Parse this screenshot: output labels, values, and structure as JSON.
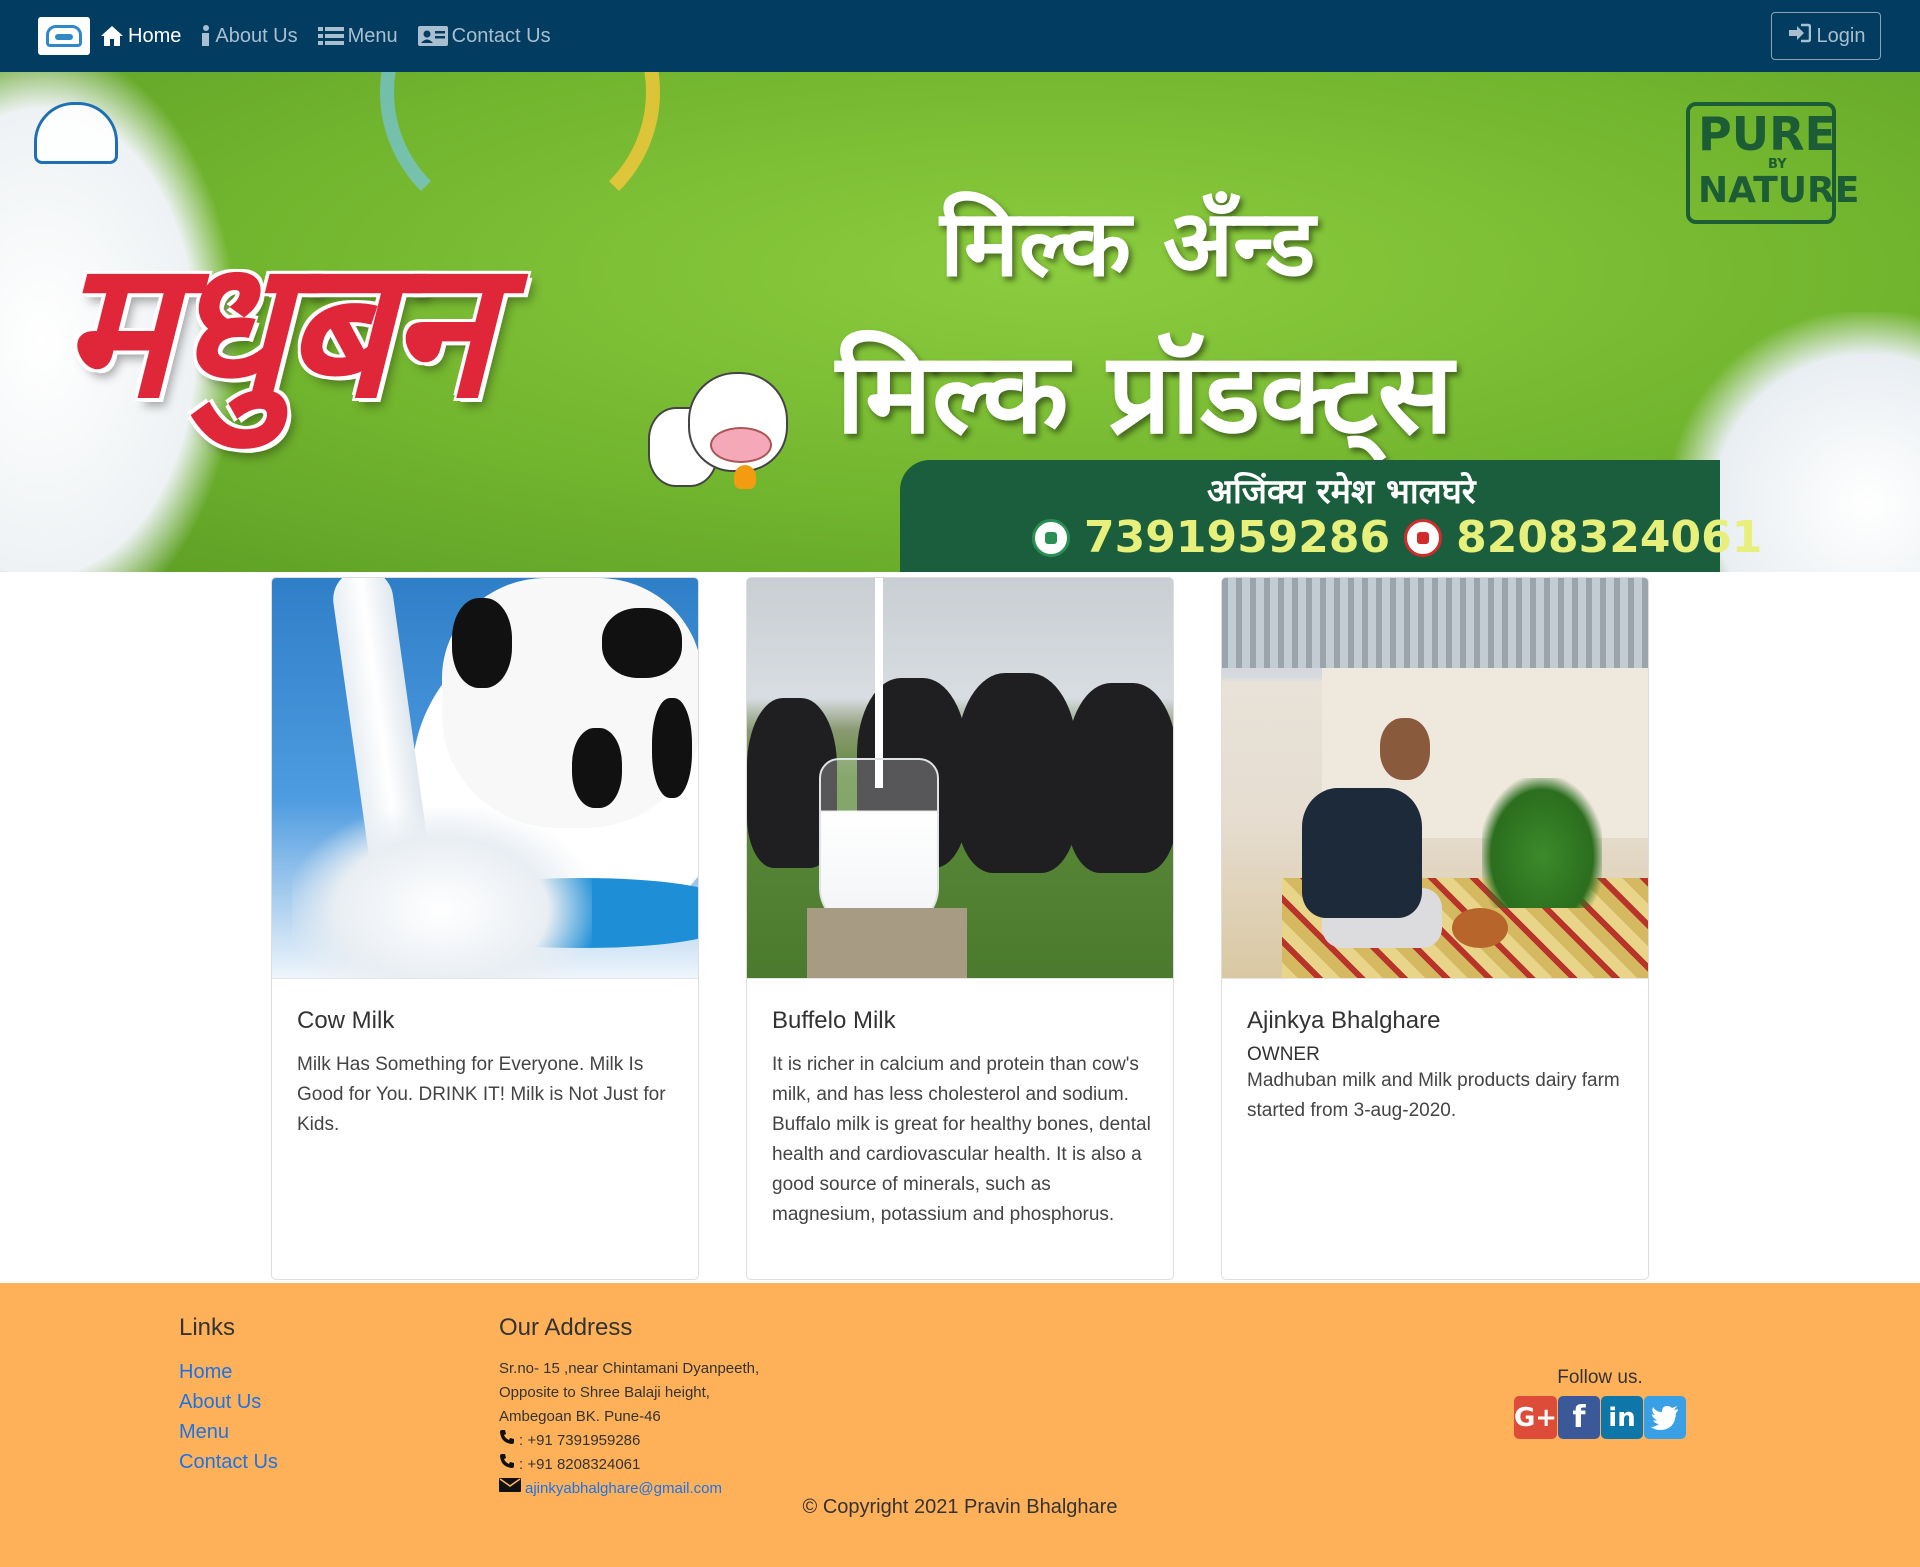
{
  "nav": {
    "items": [
      {
        "label": "Home",
        "icon": "home-icon",
        "active": true
      },
      {
        "label": "About Us",
        "icon": "info-icon",
        "active": false
      },
      {
        "label": "Menu",
        "icon": "list-icon",
        "active": false
      },
      {
        "label": "Contact Us",
        "icon": "contact-card-icon",
        "active": false
      }
    ],
    "login_label": "Login"
  },
  "banner": {
    "brand_text": "मधुबन",
    "title_line1": "मिल्क अँन्ड",
    "title_line2": "मिल्क प्रॉडक्ट्स",
    "badge_line1": "PURE",
    "badge_line2": "BY",
    "badge_line3": "NATURE",
    "owner_name": "अजिंक्य रमेश भालघरे",
    "phone1": "7391959286",
    "phone2": "8208324061"
  },
  "cards": [
    {
      "title": "Cow Milk",
      "subtitle": "",
      "text": "Milk Has Something for Everyone. Milk Is Good for You. DRINK IT! Milk is Not Just for Kids."
    },
    {
      "title": "Buffelo Milk",
      "subtitle": "",
      "text": "It is richer in calcium and protein than cow's milk, and has less cholesterol and sodium. Buffalo milk is great for healthy bones, dental health and cardiovascular health. It is also a good source of minerals, such as magnesium, potassium and phosphorus."
    },
    {
      "title": "Ajinkya Bhalghare",
      "subtitle": "OWNER",
      "text": "Madhuban milk and Milk products dairy farm started from 3-aug-2020."
    }
  ],
  "footer": {
    "links_heading": "Links",
    "links": [
      "Home",
      "About Us",
      "Menu",
      "Contact Us"
    ],
    "address_heading": "Our Address",
    "address_lines": [
      "Sr.no- 15 ,near Chintamani Dyanpeeth,",
      "Opposite to Shree Balaji height,",
      "Ambegoan BK. Pune-46"
    ],
    "phone1": ": +91 7391959286",
    "phone2": ": +91 8208324061",
    "email": "ajinkyabhalghare@gmail.com",
    "follow_label": "Follow us.",
    "social_icons": [
      "google-plus-icon",
      "facebook-icon",
      "linkedin-icon",
      "twitter-icon"
    ],
    "copyright": "© Copyright 2021 Pravin Bhalghare"
  },
  "colors": {
    "navbar": "#023c60",
    "footer": "#ffb15a",
    "link": "#1a73e8",
    "banner_green": "#72b52e",
    "brand_red": "#e0273a"
  }
}
